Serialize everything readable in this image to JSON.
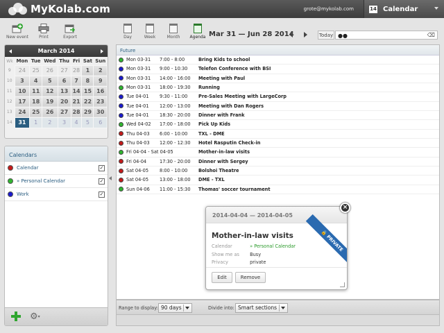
{
  "header": {
    "logo_text": "MyKolab.com",
    "user_email": "grote@mykolab.com",
    "task_icon_number": "14",
    "task_label": "Calendar"
  },
  "toolbar_left": {
    "new_event": "New event",
    "print": "Print",
    "export": "Export"
  },
  "toolbar_right": {
    "views": [
      "Day",
      "Week",
      "Month",
      "Agenda"
    ],
    "active_view": "Agenda",
    "date_range": "Mar 31 — Jun 28 2014",
    "today": "Today",
    "search_placeholder": ""
  },
  "minical": {
    "month_label": "March 2014",
    "week_header": "Wk",
    "day_headers": [
      "Mon",
      "Tue",
      "Wed",
      "Thu",
      "Fri",
      "Sat",
      "Sun"
    ],
    "weeks": [
      {
        "wk": "9",
        "days": [
          "24",
          "25",
          "26",
          "27",
          "28",
          "1",
          "2"
        ]
      },
      {
        "wk": "10",
        "days": [
          "3",
          "4",
          "5",
          "6",
          "7",
          "8",
          "9"
        ]
      },
      {
        "wk": "11",
        "days": [
          "10",
          "11",
          "12",
          "13",
          "14",
          "15",
          "16"
        ]
      },
      {
        "wk": "12",
        "days": [
          "17",
          "18",
          "19",
          "20",
          "21",
          "22",
          "23"
        ]
      },
      {
        "wk": "13",
        "days": [
          "24",
          "25",
          "26",
          "27",
          "28",
          "29",
          "30"
        ]
      },
      {
        "wk": "14",
        "days": [
          "31",
          "1",
          "2",
          "3",
          "4",
          "5",
          "6"
        ]
      }
    ]
  },
  "calendars": {
    "title": "Calendars",
    "items": [
      {
        "name": "Calendar",
        "color": "#c41a1a",
        "checked": "✓"
      },
      {
        "name": "» Personal Calendar",
        "color": "#2fb52f",
        "checked": "✓"
      },
      {
        "name": "Work",
        "color": "#1a1acc",
        "checked": "✓"
      }
    ]
  },
  "list": {
    "section": "Future",
    "events": [
      {
        "color": "#2fb52f",
        "date": "Mon 03-31",
        "time": "7:00 - 8:00",
        "title": "Bring Kids to school"
      },
      {
        "color": "#1a1acc",
        "date": "Mon 03-31",
        "time": "9:00 - 10:30",
        "title": "Telefon Conference with BSI"
      },
      {
        "color": "#1a1acc",
        "date": "Mon 03-31",
        "time": "14:00 - 16:00",
        "title": "Meeting with Paul"
      },
      {
        "color": "#2fb52f",
        "date": "Mon 03-31",
        "time": "18:00 - 19:30",
        "title": "Running"
      },
      {
        "color": "#1a1acc",
        "date": "Tue 04-01",
        "time": "9:30 - 11:00",
        "title": "Pre-Sales Meeting with LargeCorp"
      },
      {
        "color": "#1a1acc",
        "date": "Tue 04-01",
        "time": "12:00 - 13:00",
        "title": "Meeting with Dan Rogers"
      },
      {
        "color": "#1a1acc",
        "date": "Tue 04-01",
        "time": "18:30 - 20:00",
        "title": "Dinner with Frank"
      },
      {
        "color": "#2fb52f",
        "date": "Wed 04-02",
        "time": "17:00 - 18:00",
        "title": "Pick Up Kids"
      },
      {
        "color": "#c41a1a",
        "date": "Thu 04-03",
        "time": "6:00 - 10:00",
        "title": "TXL - DME"
      },
      {
        "color": "#c41a1a",
        "date": "Thu 04-03",
        "time": "12:00 - 12:30",
        "title": "Hotel Rasputin Check-in"
      },
      {
        "color": "#2fb52f",
        "date": "Fri 04-04 - Sat 04-05",
        "time": "",
        "title": "Mother-in-law visits"
      },
      {
        "color": "#c41a1a",
        "date": "Fri 04-04",
        "time": "17:30 - 20:00",
        "title": "Dinner with Sergey"
      },
      {
        "color": "#c41a1a",
        "date": "Sat 04-05",
        "time": "8:00 - 10:00",
        "title": "Bolshoi Theatre"
      },
      {
        "color": "#c41a1a",
        "date": "Sat 04-05",
        "time": "13:00 - 18:00",
        "title": "DME - TXL"
      },
      {
        "color": "#2fb52f",
        "date": "Sun 04-06",
        "time": "11:00 - 15:30",
        "title": "Thomas' soccer tournament"
      }
    ]
  },
  "list_footer": {
    "range_label": "Range to display:",
    "range_value": "90 days",
    "divide_label": "Divide into:",
    "divide_value": "Smart sections"
  },
  "popup": {
    "date": "2014-04-04 — 2014-04-05",
    "title": "Mother-in-law visits",
    "ribbon": "🔒 PRIVATE",
    "calendar_label": "Calendar",
    "calendar_value": "» Personal Calendar",
    "showme_label": "Show me as",
    "showme_value": "Busy",
    "privacy_label": "Privacy",
    "privacy_value": "private",
    "edit": "Edit",
    "remove": "Remove",
    "close": "×"
  }
}
